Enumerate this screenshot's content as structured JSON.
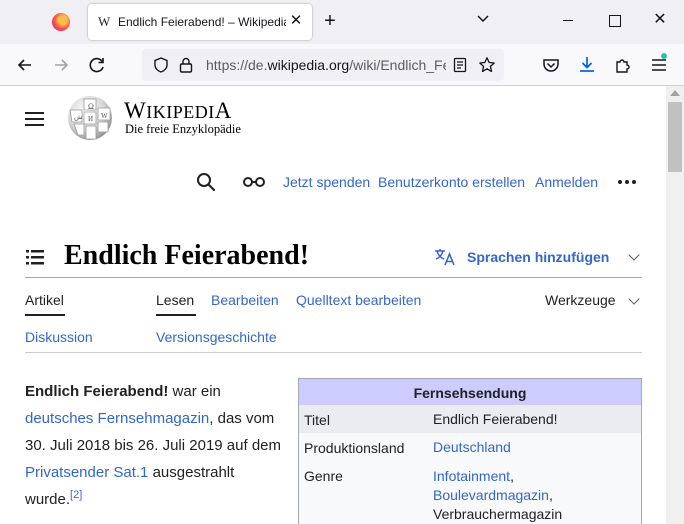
{
  "browser": {
    "tab_title": "Endlich Feierabend! – Wikipedia",
    "tab_favicon": "W",
    "url_prefix": "https://de.",
    "url_domain": "wikipedia.org",
    "url_path": "/wiki/Endlich_Fe"
  },
  "header": {
    "logo_wordmark_first": "W",
    "logo_wordmark_rest": "IKIPEDI",
    "logo_wordmark_last": "A",
    "logo_tagline": "Die freie Enzyklopädie",
    "links": [
      "Jetzt spenden",
      "Benutzerkonto erstellen",
      "Anmelden"
    ]
  },
  "article": {
    "title": "Endlich Feierabend!",
    "languages_label": "Sprachen hinzufügen",
    "tabs_left": [
      "Artikel",
      "Diskussion"
    ],
    "tabs_right": [
      "Lesen",
      "Bearbeiten",
      "Quelltext bearbeiten",
      "Versionsgeschichte"
    ],
    "tools_label": "Werkzeuge",
    "lead": {
      "bold": "Endlich Feierabend!",
      "t1": " war ein ",
      "link1": "deutsches Fernsehmagazin",
      "t2": ", das vom 30. Juli 2018 bis 26. Juli 2019 auf dem ",
      "link2": "Privatsender Sat.1",
      "t3": " ausgestrahlt wurde.",
      "ref": "[2]"
    }
  },
  "infobox": {
    "heading": "Fernsehsendung",
    "rows": [
      {
        "label": "Titel",
        "value": "Endlich Feierabend!"
      },
      {
        "label": "Produktionsland",
        "value": "Deutschland"
      },
      {
        "label": "Genre",
        "value1": "Infotainment",
        "value2": "Boulevardmagazin",
        "value3": "Verbrauchermagazin"
      }
    ],
    "comma": ","
  },
  "colors": {
    "link": "#3366cc",
    "infobox_header": "#ccccff"
  }
}
